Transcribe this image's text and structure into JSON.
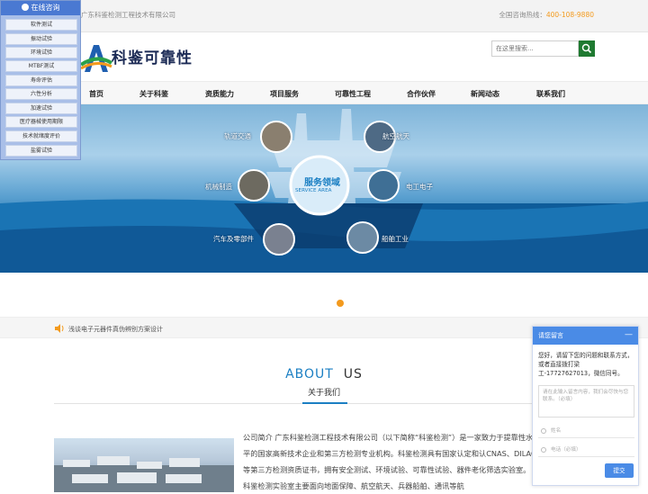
{
  "topbar": {
    "company": "广东科鉴检测工程技术有限公司",
    "hotline_label": "全国咨询热线：",
    "hotline_number": "400-108-9880"
  },
  "logo": {
    "text": "科鉴可靠性"
  },
  "search": {
    "placeholder": "在这里搜索..."
  },
  "nav": {
    "items": [
      "首页",
      "关于科鉴",
      "资质能力",
      "项目服务",
      "可靠性工程",
      "合作伙伴",
      "新闻动态",
      "联系我们"
    ]
  },
  "banner": {
    "center_cn": "服务领域",
    "center_en": "SERVICE AREA",
    "areas": [
      "轨道交通",
      "航空航天",
      "机械制造",
      "电工电子",
      "汽车及零部件",
      "船舶工业"
    ]
  },
  "ticker": {
    "text": "浅谈电子元器件真伪辨别方案设计"
  },
  "about": {
    "title_a": "ABOUT",
    "title_b": "US",
    "subtitle": "关于我们",
    "body": "公司简介 广东科鉴检测工程技术有限公司（以下简称“科鉴检测”）是一家致力于提靠性水平的国家高新技术企业和第三方检测专业机构。科鉴检测具有国家认定和认CNAS、DILAC等第三方检测资质证书，拥有安全测试、环境试验、可靠性试验、器件老化筛选实验室。 科鉴检测实验室主要面向地面保障、航空航天、兵器船舶、通讯等航"
  },
  "float_menu": {
    "title": "在线咨询",
    "items": [
      "软件测试",
      "振动试验",
      "环境试验",
      "MTBF测试",
      "寿命评估",
      "六性分析",
      "加速试验",
      "医疗器械使用期限",
      "技术就绪度评价",
      "盐雾试验"
    ]
  },
  "chat": {
    "title": "请您留言",
    "greeting": "您好，请留下您的问题和联系方式，或者直接拨打梁工-17727627013，微信同号。",
    "message_placeholder": "请在此输入留言内容，我们会尽快与您联系。（必填）",
    "name_placeholder": "姓名",
    "phone_placeholder": "电话（必填）",
    "submit_label": "提交"
  },
  "colors": {
    "accent_orange": "#f39a1e",
    "accent_blue": "#1b7fc3",
    "brand_green": "#1f7a31"
  }
}
